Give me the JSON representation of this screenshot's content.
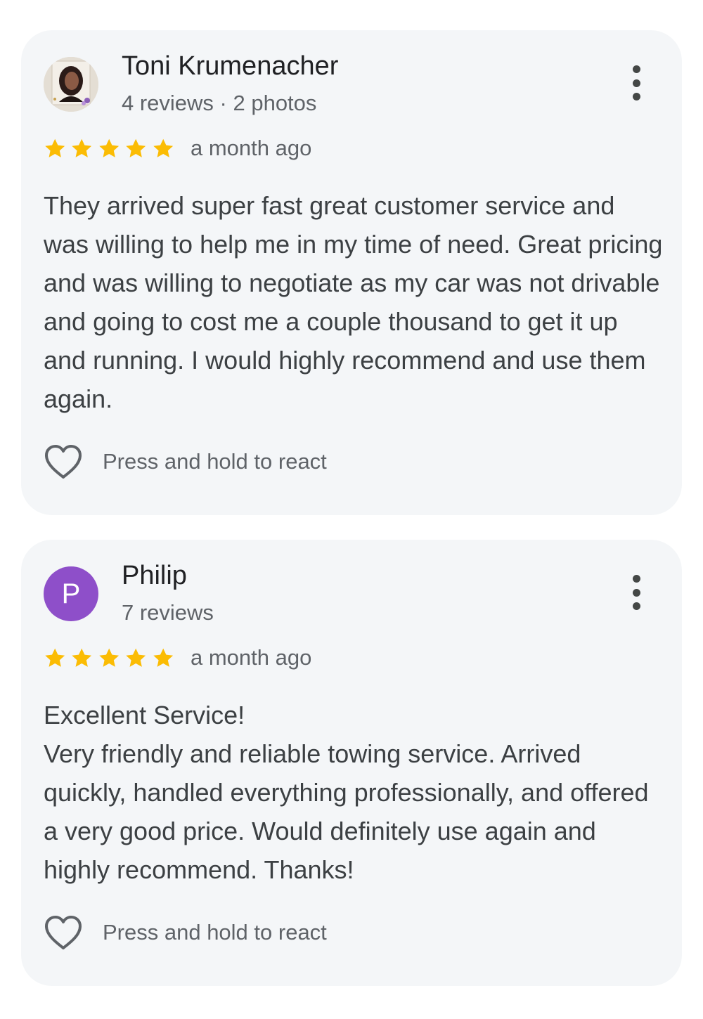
{
  "reviews": [
    {
      "reviewer_name": "Toni Krumenacher",
      "reviewer_meta": "4 reviews · 2 photos",
      "avatar": "photo",
      "rating": 5,
      "date": "a month ago",
      "text": "They arrived super fast great customer service and was willing to help me in my time of need. Great pricing and was willing to negotiate as my car was not drivable and going to cost me a couple thousand to get it up and running. I would highly recommend and use them again.",
      "react_label": "Press and hold to react"
    },
    {
      "reviewer_name": "Philip",
      "reviewer_meta": "7 reviews",
      "avatar": "P",
      "avatar_color": "#8e4fc9",
      "rating": 5,
      "date": "a month ago",
      "text": "Excellent Service!\nVery friendly and reliable towing service. Arrived quickly, handled everything professionally, and offered a very good price. Would definitely use again and highly recommend. Thanks!",
      "react_label": "Press and hold to react"
    }
  ],
  "colors": {
    "star": "#fbbc04",
    "card_background": "#f4f6f8",
    "secondary_text": "#5f6368"
  },
  "icons": {
    "more": "more-vert-icon",
    "react": "heart-outline-icon",
    "star": "star-icon"
  }
}
